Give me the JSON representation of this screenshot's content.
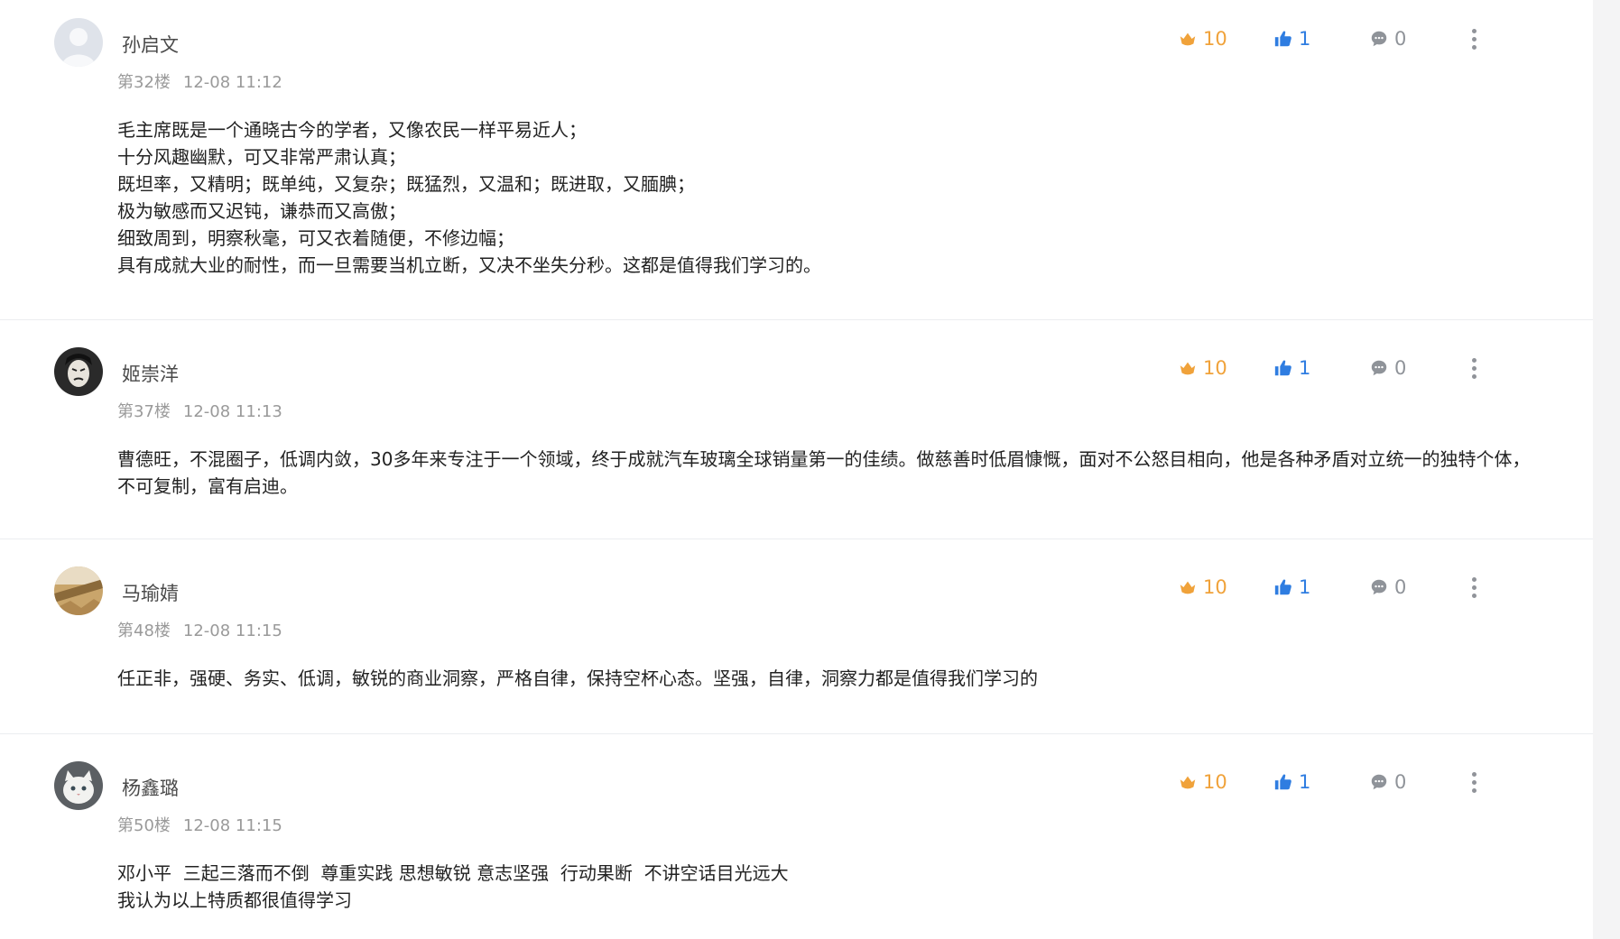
{
  "comments": [
    {
      "username": "孙启文",
      "floor": "第32楼",
      "time": "12-08 11:12",
      "lines": [
        "毛主席既是一个通晓古今的学者，又像农民一样平易近人；",
        "十分风趣幽默，可又非常严肃认真；",
        "既坦率，又精明；既单纯，又复杂；既猛烈，又温和；既进取，又腼腆；",
        "极为敏感而又迟钝，谦恭而又高傲；",
        "细致周到，明察秋毫，可又衣着随便，不修边幅；",
        "具有成就大业的耐性，而一旦需要当机立断，又决不坐失分秒。这都是值得我们学习的。"
      ],
      "flowers": "10",
      "likes": "1",
      "replies": "0"
    },
    {
      "username": "姬崇洋",
      "floor": "第37楼",
      "time": "12-08 11:13",
      "lines": [
        "曹德旺，不混圈子，低调内敛，30多年来专注于一个领域，终于成就汽车玻璃全球销量第一的佳绩。做慈善时低眉慷慨，面对不公怒目相向，他是各种矛盾对立统一的独特个体，不可复制，富有启迪。"
      ],
      "flowers": "10",
      "likes": "1",
      "replies": "0"
    },
    {
      "username": "马瑜婧",
      "floor": "第48楼",
      "time": "12-08 11:15",
      "lines": [
        "任正非，强硬、务实、低调，敏锐的商业洞察，严格自律，保持空杯心态。坚强，自律，洞察力都是值得我们学习的"
      ],
      "flowers": "10",
      "likes": "1",
      "replies": "0"
    },
    {
      "username": "杨鑫璐",
      "floor": "第50楼",
      "time": "12-08 11:15",
      "lines": [
        "邓小平  三起三落而不倒  尊重实践 思想敏锐 意志坚强  行动果断  不讲空话目光远大",
        "我认为以上特质都很值得学习"
      ],
      "flowers": "10",
      "likes": "1",
      "replies": "0"
    }
  ],
  "icons": {
    "flower": "flower-icon",
    "like": "thumbs-up-icon",
    "reply": "comment-bubble-icon",
    "more": "more-vertical-icon"
  },
  "colors": {
    "flower": "#f0a23a",
    "like": "#2f7de1",
    "reply": "#8f9399",
    "meta": "#9a9a9a"
  }
}
